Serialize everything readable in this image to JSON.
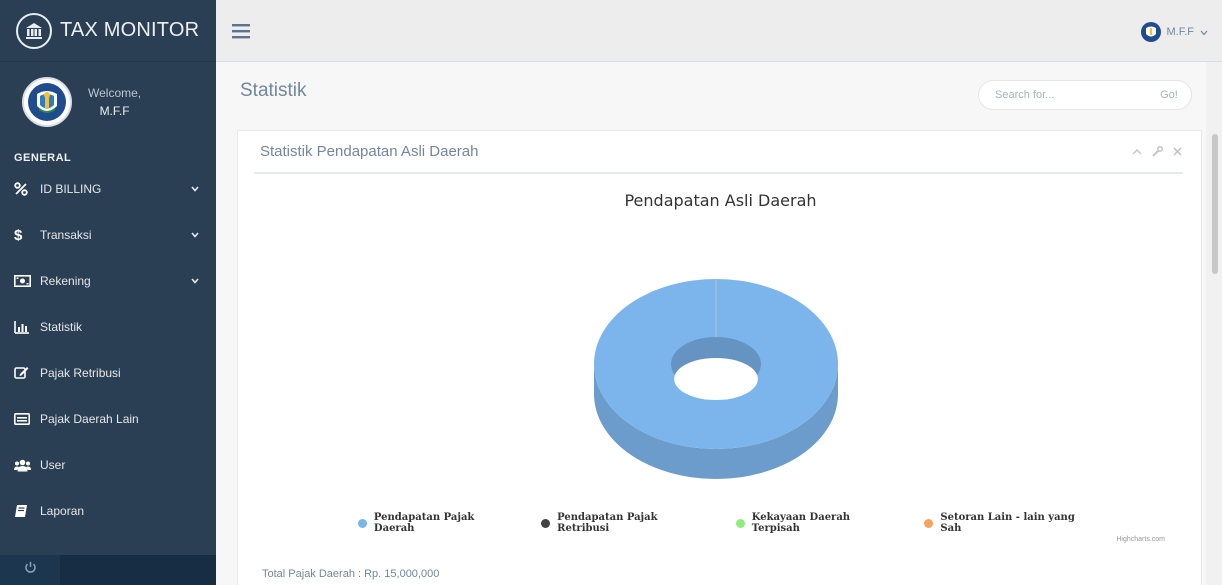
{
  "brand": {
    "title": "TAX MONITOR",
    "icon": "bank-icon"
  },
  "profile": {
    "welcome": "Welcome,",
    "name": "M.F.F"
  },
  "sidebar": {
    "section": "GENERAL",
    "items": [
      {
        "label": "ID BILLING",
        "icon": "percent-icon",
        "has_submenu": true
      },
      {
        "label": "Transaksi",
        "icon": "dollar-icon",
        "has_submenu": true
      },
      {
        "label": "Rekening",
        "icon": "money-bill-icon",
        "has_submenu": true
      },
      {
        "label": "Statistik",
        "icon": "bar-chart-icon",
        "has_submenu": false
      },
      {
        "label": "Pajak Retribusi",
        "icon": "edit-icon",
        "has_submenu": false
      },
      {
        "label": "Pajak Daerah Lain",
        "icon": "card-icon",
        "has_submenu": false
      },
      {
        "label": "User",
        "icon": "users-icon",
        "has_submenu": false
      },
      {
        "label": "Laporan",
        "icon": "book-icon",
        "has_submenu": false
      }
    ],
    "footer_icon": "power-icon"
  },
  "topbar": {
    "user": "M.F.F"
  },
  "page": {
    "title": "Statistik"
  },
  "search": {
    "placeholder": "Search for...",
    "button": "Go!"
  },
  "panel": {
    "title": "Statistik Pendapatan Asli Daerah",
    "total": "Total Pajak Daerah : Rp. 15,000,000",
    "credits": "Highcharts.com"
  },
  "colors": {
    "sidebar": "#2a3f54",
    "accent": "#7cb5ec"
  },
  "chart_data": {
    "type": "pie",
    "variant": "3d-donut",
    "title": "Pendapatan Asli Daerah",
    "slices": [
      {
        "name": "Pendapatan Pajak Daerah",
        "value": 15000000,
        "color": "#7cb5ec"
      },
      {
        "name": "Pendapatan Pajak Retribusi",
        "value": 0,
        "color": "#434348"
      },
      {
        "name": "Kekayaan Daerah Terpisah",
        "value": 0,
        "color": "#90ed7d"
      },
      {
        "name": "Setoran Lain - lain yang Sah",
        "value": 0,
        "color": "#f7a35c"
      }
    ],
    "legend_position": "bottom"
  }
}
